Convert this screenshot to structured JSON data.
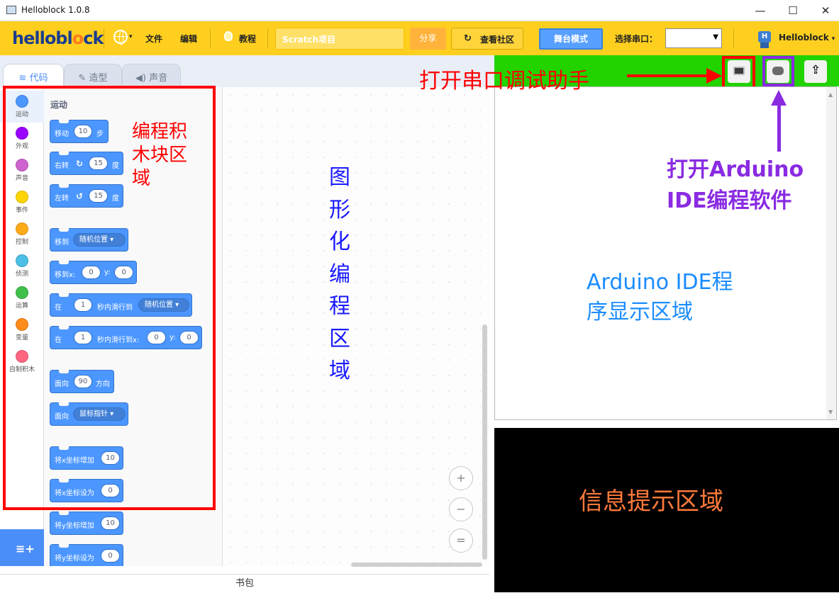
{
  "window": {
    "title": "Helloblock 1.0.8",
    "minimize": "—",
    "maximize": "☐",
    "close": "✕"
  },
  "menubar": {
    "logo_left": "hellobl",
    "logo_o": "o",
    "logo_right": "ck",
    "file": "文件",
    "edit": "编辑",
    "tutorial": "教程",
    "project_name": "Scratch项目",
    "share": "分享",
    "community": "查看社区",
    "stage_mode": "舞台模式",
    "select_port": "选择串口：",
    "port_value": "",
    "user": "Helloblock"
  },
  "tabs": [
    {
      "label": "代码",
      "icon": "code-icon"
    },
    {
      "label": "造型",
      "icon": "brush-icon"
    },
    {
      "label": "声音",
      "icon": "speaker-icon"
    }
  ],
  "categories": [
    {
      "label": "运动",
      "color": "#4c97ff"
    },
    {
      "label": "外观",
      "color": "#9900ff"
    },
    {
      "label": "声音",
      "color": "#cf63cf"
    },
    {
      "label": "事件",
      "color": "#ffd500"
    },
    {
      "label": "控制",
      "color": "#ffab19"
    },
    {
      "label": "侦测",
      "color": "#4cbfe6"
    },
    {
      "label": "运算",
      "color": "#40bf4a"
    },
    {
      "label": "变量",
      "color": "#ff8c1a"
    },
    {
      "label": "自制积木",
      "color": "#ff6680"
    }
  ],
  "flyout": {
    "heading": "运动",
    "blocks": {
      "move": {
        "text": "移动",
        "value": "10",
        "unit": "步"
      },
      "turn_right": {
        "text": "右转",
        "value": "15",
        "unit": "度"
      },
      "turn_left": {
        "text": "左转",
        "value": "15",
        "unit": "度"
      },
      "goto": {
        "text": "移到",
        "option": "随机位置"
      },
      "goto_xy": {
        "text": "移到x:",
        "x": "0",
        "y_label": "y:",
        "y": "0"
      },
      "glide": {
        "text": "在",
        "value": "1",
        "mid": "秒内滑行到",
        "option": "随机位置"
      },
      "glide_xy": {
        "text": "在",
        "value": "1",
        "mid": "秒内滑行到x:",
        "x": "0",
        "y_label": "y:",
        "y": "0"
      },
      "point": {
        "text": "面向",
        "value": "90",
        "unit": "方向"
      },
      "point_towards": {
        "text": "面向",
        "option": "鼠标指针"
      },
      "change_x": {
        "text": "将x坐标增加",
        "value": "10"
      },
      "set_x": {
        "text": "将x坐标设为",
        "value": "0"
      },
      "change_y": {
        "text": "将y坐标增加",
        "value": "10"
      },
      "set_y": {
        "text": "将y坐标设为",
        "value": "0"
      }
    }
  },
  "zoom": {
    "in": "+",
    "out": "−",
    "reset": "="
  },
  "backpack": "书包",
  "annotations": {
    "blocks_area": [
      "编程积",
      "木块区",
      "域"
    ],
    "code_area": "图形化编程区域",
    "serial": "打开串口调试助手",
    "arduino": [
      "打开Arduino",
      "IDE编程软件"
    ],
    "ide_area": [
      "Arduino IDE程",
      "序显示区域"
    ],
    "info_area": "信息提示区域"
  }
}
